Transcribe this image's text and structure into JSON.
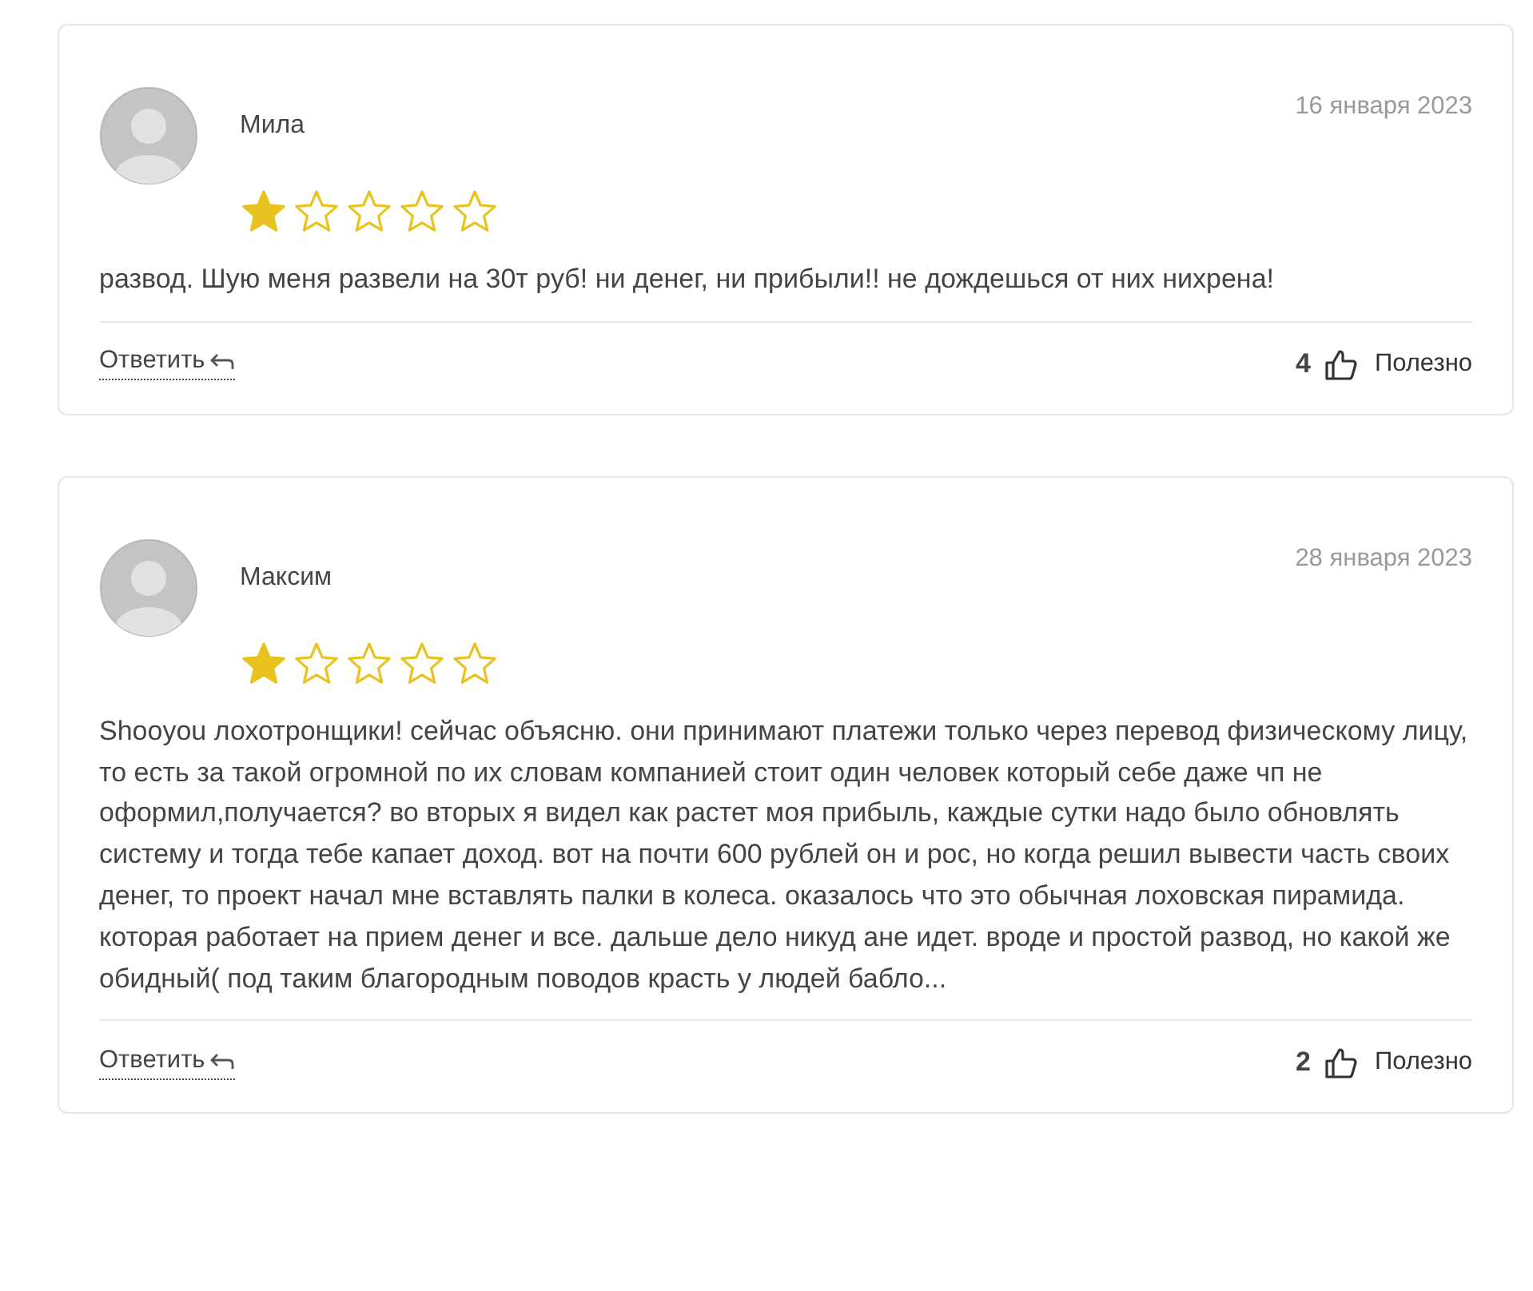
{
  "reviews": [
    {
      "author": "Мила",
      "date": "16 января 2023",
      "stars": 1,
      "text": "развод. Шую меня развели на 30т руб! ни денег, ни прибыли!! не дождешься от них нихрена!",
      "reply": "Ответить",
      "likes": "4",
      "helpful": "Полезно"
    },
    {
      "author": "Максим",
      "date": "28 января 2023",
      "stars": 1,
      "text": "Shooyou лохотронщики! сейчас объясню. они принимают платежи только через перевод физическому лицу, то есть за такой огромной по их словам компанией стоит один человек который себе даже чп не оформил,получается? во вторых я видел как растет моя прибыль, каждые сутки надо было обновлять систему и тогда тебе капает доход. вот на почти 600 рублей он и рос, но когда решил вывести часть своих денег, то проект начал мне вставлять палки в колеса. оказалось что это обычная лоховская пирамида. которая работает на прием денег и все. дальше дело никуд ане идет. вроде и простой развод, но какой же обидный( под таким благородным поводов красть у людей бабло...",
      "reply": "Ответить",
      "likes": "2",
      "helpful": "Полезно"
    }
  ]
}
